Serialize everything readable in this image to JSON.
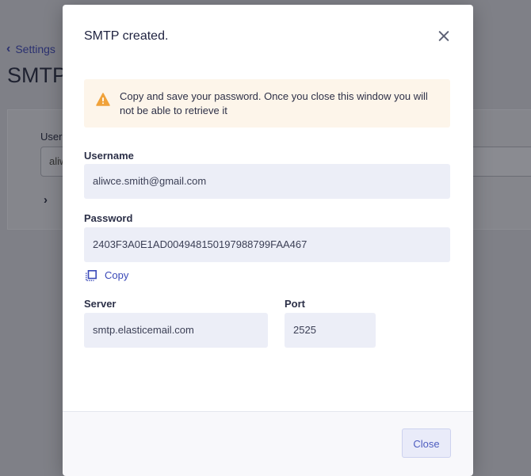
{
  "background": {
    "back_label": "Settings",
    "page_title": "SMTP",
    "field_label": "User",
    "field_value": "aliw"
  },
  "modal": {
    "title": "SMTP created.",
    "alert_text": "Copy and save your password. Once you close this window you will not be able to retrieve it",
    "username_label": "Username",
    "username_value": "aliwce.smith@gmail.com",
    "password_label": "Password",
    "password_value": "2403F3A0E1AD004948150197988799FAA467",
    "copy_label": "Copy",
    "server_label": "Server",
    "server_value": "smtp.elasticemail.com",
    "port_label": "Port",
    "port_value": "2525",
    "close_button": "Close"
  },
  "colors": {
    "accent": "#3a49b8",
    "warning": "#f0a23a",
    "alert_bg": "#fdf5ea",
    "input_bg": "#eceef7"
  }
}
